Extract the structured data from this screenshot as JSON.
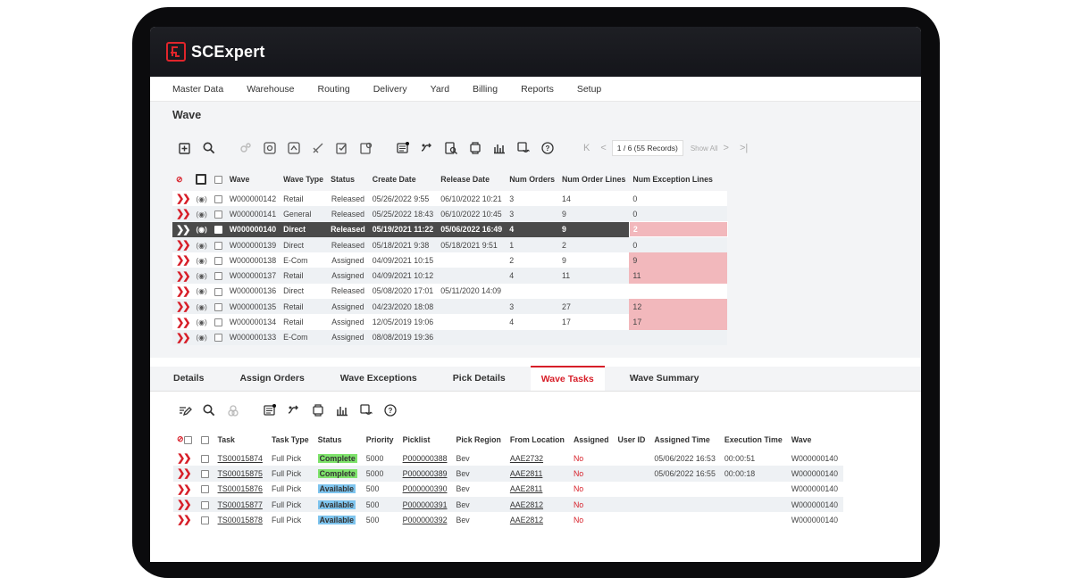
{
  "app": {
    "name": "SCExpert"
  },
  "menu": [
    "Master Data",
    "Warehouse",
    "Routing",
    "Delivery",
    "Yard",
    "Billing",
    "Reports",
    "Setup"
  ],
  "page_title": "Wave",
  "pager": {
    "first": "K",
    "prev": "<",
    "status": "1 / 6 (55 Records)",
    "show_all": "Show All",
    "next": ">",
    "last": ">|"
  },
  "wave_columns": [
    "Wave",
    "Wave Type",
    "Status",
    "Create Date",
    "Release Date",
    "Num Orders",
    "Num Order Lines",
    "Num Exception Lines"
  ],
  "waves": [
    {
      "wave": "W000000142",
      "type": "Retail",
      "status": "Released",
      "create": "05/26/2022 9:55",
      "release": "06/10/2022 10:21",
      "orders": "3",
      "lines": "14",
      "exceptions": "0",
      "flag": false
    },
    {
      "wave": "W000000141",
      "type": "General",
      "status": "Released",
      "create": "05/25/2022 18:43",
      "release": "06/10/2022 10:45",
      "orders": "3",
      "lines": "9",
      "exceptions": "0",
      "flag": false
    },
    {
      "wave": "W000000140",
      "type": "Direct",
      "status": "Released",
      "create": "05/19/2021 11:22",
      "release": "05/06/2022 16:49",
      "orders": "4",
      "lines": "9",
      "exceptions": "2",
      "flag": true
    },
    {
      "wave": "W000000139",
      "type": "Direct",
      "status": "Released",
      "create": "05/18/2021 9:38",
      "release": "05/18/2021 9:51",
      "orders": "1",
      "lines": "2",
      "exceptions": "0",
      "flag": false
    },
    {
      "wave": "W000000138",
      "type": "E-Com",
      "status": "Assigned",
      "create": "04/09/2021 10:15",
      "release": "",
      "orders": "2",
      "lines": "9",
      "exceptions": "9",
      "flag": true
    },
    {
      "wave": "W000000137",
      "type": "Retail",
      "status": "Assigned",
      "create": "04/09/2021 10:12",
      "release": "",
      "orders": "4",
      "lines": "11",
      "exceptions": "11",
      "flag": true
    },
    {
      "wave": "W000000136",
      "type": "Direct",
      "status": "Released",
      "create": "05/08/2020 17:01",
      "release": "05/11/2020 14:09",
      "orders": "",
      "lines": "",
      "exceptions": "",
      "flag": false
    },
    {
      "wave": "W000000135",
      "type": "Retail",
      "status": "Assigned",
      "create": "04/23/2020 18:08",
      "release": "",
      "orders": "3",
      "lines": "27",
      "exceptions": "12",
      "flag": true
    },
    {
      "wave": "W000000134",
      "type": "Retail",
      "status": "Assigned",
      "create": "12/05/2019 19:06",
      "release": "",
      "orders": "4",
      "lines": "17",
      "exceptions": "17",
      "flag": true
    },
    {
      "wave": "W000000133",
      "type": "E-Com",
      "status": "Assigned",
      "create": "08/08/2019 19:36",
      "release": "",
      "orders": "",
      "lines": "",
      "exceptions": "",
      "flag": false
    }
  ],
  "tabs": [
    "Details",
    "Assign Orders",
    "Wave Exceptions",
    "Pick Details",
    "Wave Tasks",
    "Wave Summary"
  ],
  "active_tab": "Wave Tasks",
  "task_columns": [
    "Task",
    "Task Type",
    "Status",
    "Priority",
    "Picklist",
    "Pick Region",
    "From Location",
    "Assigned",
    "User ID",
    "Assigned Time",
    "Execution Time",
    "Wave"
  ],
  "tasks": [
    {
      "task": "TS00015874",
      "type": "Full Pick",
      "status": "Complete",
      "priority": "5000",
      "picklist": "P000000388",
      "region": "Bev",
      "from": "AAE2732",
      "assigned": "No",
      "user": "",
      "assigned_time": "05/06/2022 16:53",
      "exec_time": "00:00:51",
      "wave": "W000000140"
    },
    {
      "task": "TS00015875",
      "type": "Full Pick",
      "status": "Complete",
      "priority": "5000",
      "picklist": "P000000389",
      "region": "Bev",
      "from": "AAE2811",
      "assigned": "No",
      "user": "",
      "assigned_time": "05/06/2022 16:55",
      "exec_time": "00:00:18",
      "wave": "W000000140"
    },
    {
      "task": "TS00015876",
      "type": "Full Pick",
      "status": "Available",
      "priority": "500",
      "picklist": "P000000390",
      "region": "Bev",
      "from": "AAE2811",
      "assigned": "No",
      "user": "",
      "assigned_time": "",
      "exec_time": "",
      "wave": "W000000140"
    },
    {
      "task": "TS00015877",
      "type": "Full Pick",
      "status": "Available",
      "priority": "500",
      "picklist": "P000000391",
      "region": "Bev",
      "from": "AAE2812",
      "assigned": "No",
      "user": "",
      "assigned_time": "",
      "exec_time": "",
      "wave": "W000000140"
    },
    {
      "task": "TS00015878",
      "type": "Full Pick",
      "status": "Available",
      "priority": "500",
      "picklist": "P000000392",
      "region": "Bev",
      "from": "AAE2812",
      "assigned": "No",
      "user": "",
      "assigned_time": "",
      "exec_time": "",
      "wave": "W000000140"
    }
  ],
  "colors": {
    "accent": "#d71e28",
    "exception": "#f2b8bc",
    "complete": "#7ee36b",
    "available": "#7ec4ee",
    "selected_row": "#4a4a4a"
  }
}
